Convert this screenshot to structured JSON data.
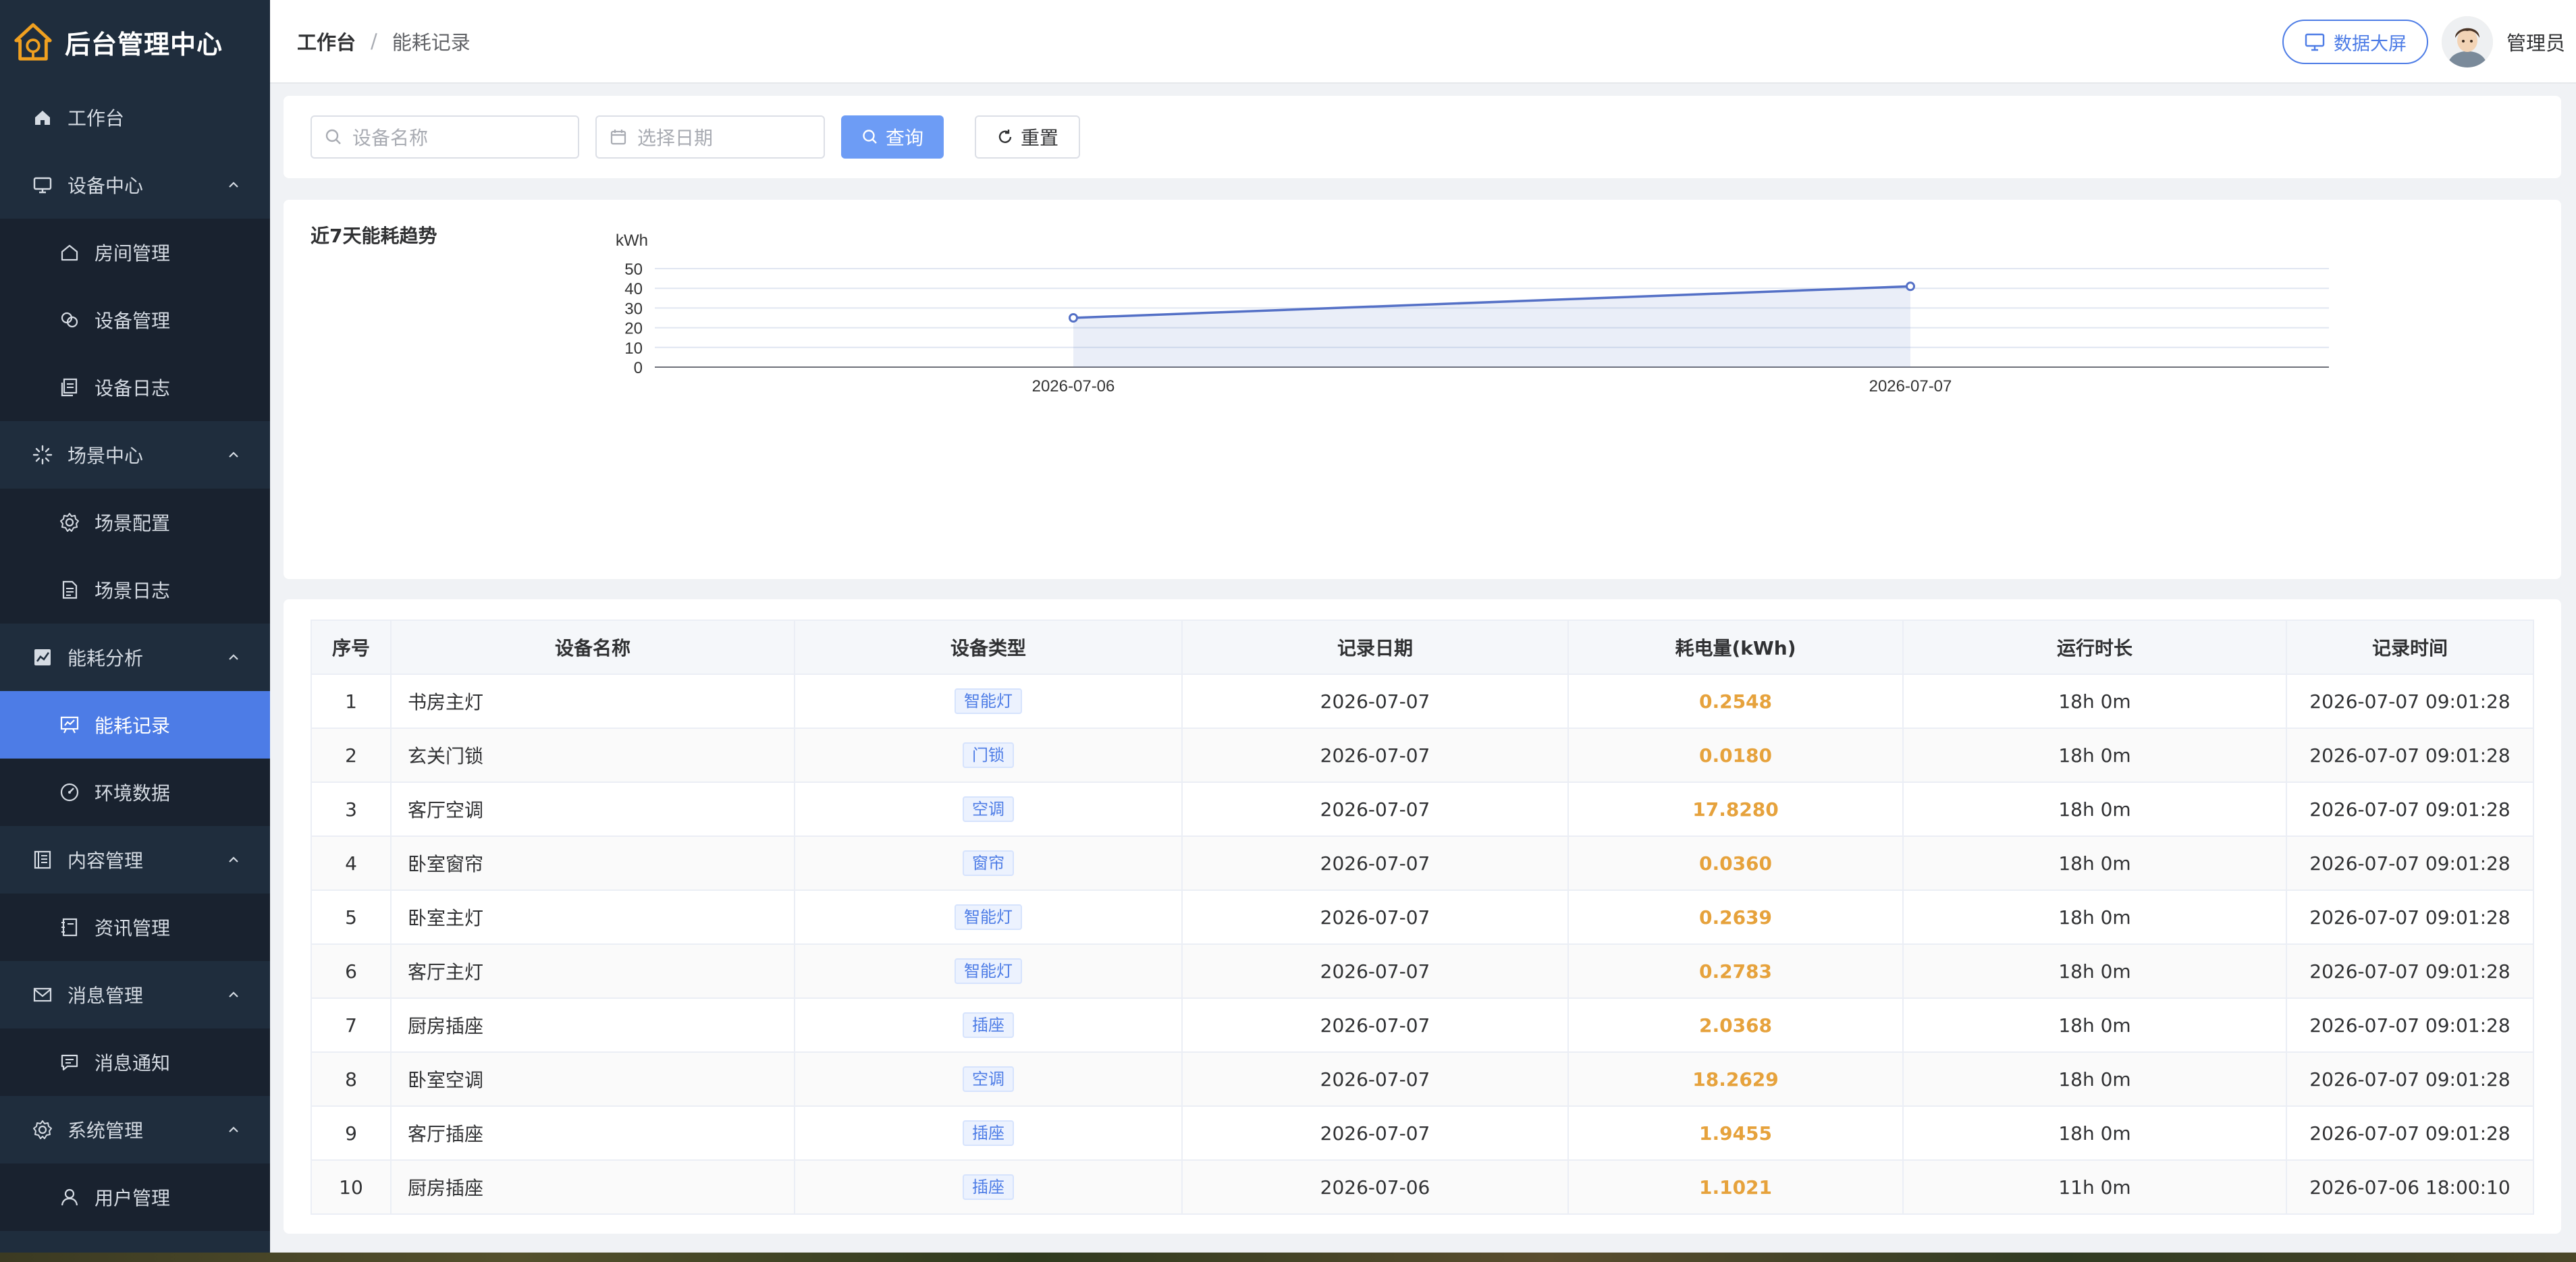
{
  "app": {
    "title": "后台管理中心"
  },
  "sidebar": {
    "items": [
      {
        "label": "工作台",
        "level": "top",
        "icon": "home-icon"
      },
      {
        "label": "设备中心",
        "level": "top",
        "icon": "monitor-icon",
        "expanded": true
      },
      {
        "label": "房间管理",
        "level": "sub",
        "icon": "house-icon"
      },
      {
        "label": "设备管理",
        "level": "sub",
        "icon": "link-icon"
      },
      {
        "label": "设备日志",
        "level": "sub",
        "icon": "document-copy-icon"
      },
      {
        "label": "场景中心",
        "level": "top",
        "icon": "loading-icon",
        "expanded": true
      },
      {
        "label": "场景配置",
        "level": "sub",
        "icon": "gear-icon"
      },
      {
        "label": "场景日志",
        "level": "sub",
        "icon": "document-icon"
      },
      {
        "label": "能耗分析",
        "level": "top",
        "icon": "chart-icon",
        "expanded": true
      },
      {
        "label": "能耗记录",
        "level": "sub",
        "icon": "data-board-icon",
        "active": true
      },
      {
        "label": "环境数据",
        "level": "sub",
        "icon": "odometer-icon"
      },
      {
        "label": "内容管理",
        "level": "top",
        "icon": "reading-icon",
        "expanded": true
      },
      {
        "label": "资讯管理",
        "level": "sub",
        "icon": "notebook-icon"
      },
      {
        "label": "消息管理",
        "level": "top",
        "icon": "message-icon",
        "expanded": true
      },
      {
        "label": "消息通知",
        "level": "sub",
        "icon": "chat-icon"
      },
      {
        "label": "系统管理",
        "level": "top",
        "icon": "setting-icon",
        "expanded": true
      },
      {
        "label": "用户管理",
        "level": "sub",
        "icon": "user-icon"
      }
    ]
  },
  "header": {
    "breadcrumb_home": "工作台",
    "breadcrumb_sep": "/",
    "breadcrumb_current": "能耗记录",
    "screen_button": "数据大屏",
    "username": "管理员"
  },
  "search": {
    "device_placeholder": "设备名称",
    "date_placeholder": "选择日期",
    "query_label": "查询",
    "reset_label": "重置"
  },
  "chart_data": {
    "type": "line",
    "title": "近7天能耗趋势",
    "ylabel": "kWh",
    "x": [
      "2026-07-06",
      "2026-07-07"
    ],
    "series": [
      {
        "values": [
          25,
          41
        ]
      }
    ],
    "yticks": [
      0,
      10,
      20,
      30,
      40,
      50
    ],
    "ylim": [
      0,
      50
    ],
    "grid": true,
    "area_fill": true,
    "color": "#5470c6"
  },
  "table": {
    "columns": [
      "序号",
      "设备名称",
      "设备类型",
      "记录日期",
      "耗电量(kWh)",
      "运行时长",
      "记录时间"
    ],
    "rows": [
      [
        "1",
        "书房主灯",
        "智能灯",
        "2026-07-07",
        "0.2548",
        "18h 0m",
        "2026-07-07 09:01:28"
      ],
      [
        "2",
        "玄关门锁",
        "门锁",
        "2026-07-07",
        "0.0180",
        "18h 0m",
        "2026-07-07 09:01:28"
      ],
      [
        "3",
        "客厅空调",
        "空调",
        "2026-07-07",
        "17.8280",
        "18h 0m",
        "2026-07-07 09:01:28"
      ],
      [
        "4",
        "卧室窗帘",
        "窗帘",
        "2026-07-07",
        "0.0360",
        "18h 0m",
        "2026-07-07 09:01:28"
      ],
      [
        "5",
        "卧室主灯",
        "智能灯",
        "2026-07-07",
        "0.2639",
        "18h 0m",
        "2026-07-07 09:01:28"
      ],
      [
        "6",
        "客厅主灯",
        "智能灯",
        "2026-07-07",
        "0.2783",
        "18h 0m",
        "2026-07-07 09:01:28"
      ],
      [
        "7",
        "厨房插座",
        "插座",
        "2026-07-07",
        "2.0368",
        "18h 0m",
        "2026-07-07 09:01:28"
      ],
      [
        "8",
        "卧室空调",
        "空调",
        "2026-07-07",
        "18.2629",
        "18h 0m",
        "2026-07-07 09:01:28"
      ],
      [
        "9",
        "客厅插座",
        "插座",
        "2026-07-07",
        "1.9455",
        "18h 0m",
        "2026-07-07 09:01:28"
      ],
      [
        "10",
        "厨房插座",
        "插座",
        "2026-07-06",
        "1.1021",
        "11h 0m",
        "2026-07-06 18:00:10"
      ]
    ]
  },
  "colors": {
    "sidebar_bg": "#1f2d3d",
    "sidebar_sub_bg": "#19222f",
    "accent": "#4d7ce6",
    "energy": "#e6a23c"
  }
}
